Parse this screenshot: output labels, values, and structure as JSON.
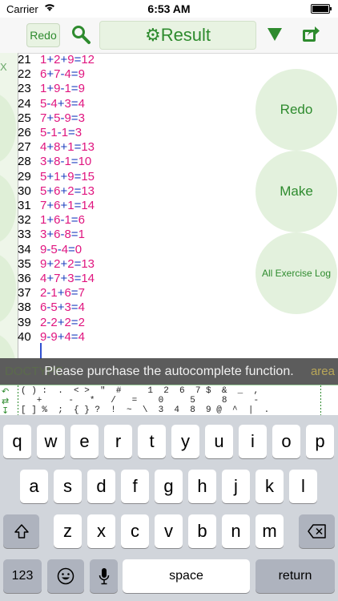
{
  "status": {
    "carrier": "Carrier",
    "time": "6:53 AM"
  },
  "toolbar": {
    "redo_label": "Redo",
    "result_label": "Result"
  },
  "side": {
    "mark": "X"
  },
  "lines": [
    {
      "n": "21",
      "a": "1",
      "o1": "+",
      "b": "2",
      "o2": "+",
      "c": "9",
      "eq": "=",
      "r": "12"
    },
    {
      "n": "22",
      "a": "6",
      "o1": "+",
      "b": "7",
      "o2": "-",
      "c": "4",
      "eq": "=",
      "r": "9"
    },
    {
      "n": "23",
      "a": "1",
      "o1": "+",
      "b": "9",
      "o2": "-",
      "c": "1",
      "eq": "=",
      "r": "9"
    },
    {
      "n": "24",
      "a": "5",
      "o1": "-",
      "b": "4",
      "o2": "+",
      "c": "3",
      "eq": "=",
      "r": "4"
    },
    {
      "n": "25",
      "a": "7",
      "o1": "+",
      "b": "5",
      "o2": "-",
      "c": "9",
      "eq": "=",
      "r": "3"
    },
    {
      "n": "26",
      "a": "5",
      "o1": "-",
      "b": "1",
      "o2": "-",
      "c": "1",
      "eq": "=",
      "r": "3"
    },
    {
      "n": "27",
      "a": "4",
      "o1": "+",
      "b": "8",
      "o2": "+",
      "c": "1",
      "eq": "=",
      "r": "13"
    },
    {
      "n": "28",
      "a": "3",
      "o1": "+",
      "b": "8",
      "o2": "-",
      "c": "1",
      "eq": "=",
      "r": "10"
    },
    {
      "n": "29",
      "a": "5",
      "o1": "+",
      "b": "1",
      "o2": "+",
      "c": "9",
      "eq": "=",
      "r": "15"
    },
    {
      "n": "30",
      "a": "5",
      "o1": "+",
      "b": "6",
      "o2": "+",
      "c": "2",
      "eq": "=",
      "r": "13"
    },
    {
      "n": "31",
      "a": "7",
      "o1": "+",
      "b": "6",
      "o2": "+",
      "c": "1",
      "eq": "=",
      "r": "14"
    },
    {
      "n": "32",
      "a": "1",
      "o1": "+",
      "b": "6",
      "o2": "-",
      "c": "1",
      "eq": "=",
      "r": "6"
    },
    {
      "n": "33",
      "a": "3",
      "o1": "+",
      "b": "6",
      "o2": "-",
      "c": "8",
      "eq": "=",
      "r": "1"
    },
    {
      "n": "34",
      "a": "9",
      "o1": "-",
      "b": "5",
      "o2": "-",
      "c": "4",
      "eq": "=",
      "r": "0"
    },
    {
      "n": "35",
      "a": "9",
      "o1": "+",
      "b": "2",
      "o2": "+",
      "c": "2",
      "eq": "=",
      "r": "13"
    },
    {
      "n": "36",
      "a": "4",
      "o1": "+",
      "b": "7",
      "o2": "+",
      "c": "3",
      "eq": "=",
      "r": "14"
    },
    {
      "n": "37",
      "a": "2",
      "o1": "-",
      "b": "1",
      "o2": "+",
      "c": "6",
      "eq": "=",
      "r": "7"
    },
    {
      "n": "38",
      "a": "6",
      "o1": "-",
      "b": "5",
      "o2": "+",
      "c": "3",
      "eq": "=",
      "r": "4"
    },
    {
      "n": "39",
      "a": "2",
      "o1": "-",
      "b": "2",
      "o2": "+",
      "c": "2",
      "eq": "=",
      "r": "2"
    },
    {
      "n": "40",
      "a": "9",
      "o1": "-",
      "b": "9",
      "o2": "+",
      "c": "4",
      "eq": "=",
      "r": "4"
    }
  ],
  "actions": {
    "redo": "Redo",
    "make": "Make",
    "log": "All Exercise Log"
  },
  "toast": {
    "message": "Please purchase the autocomplete function.",
    "behind_left": "DOCTYPE",
    "behind_right": "area"
  },
  "symbols": {
    "row1": "( ) :  .  < >  \"  #     1  2  6  7 $  &  _  ,",
    "row2": "   +     -   *   /   =    0     5     8     -",
    "row3": "[ ] %  ;  { } ?  !  ~  \\  3  4  8  9 @  ^  |  ."
  },
  "keyboard": {
    "row1": [
      "q",
      "w",
      "e",
      "r",
      "t",
      "y",
      "u",
      "i",
      "o",
      "p"
    ],
    "row2": [
      "a",
      "s",
      "d",
      "f",
      "g",
      "h",
      "j",
      "k",
      "l"
    ],
    "row3": [
      "z",
      "x",
      "c",
      "v",
      "b",
      "n",
      "m"
    ],
    "numbers": "123",
    "space": "space",
    "return": "return"
  }
}
